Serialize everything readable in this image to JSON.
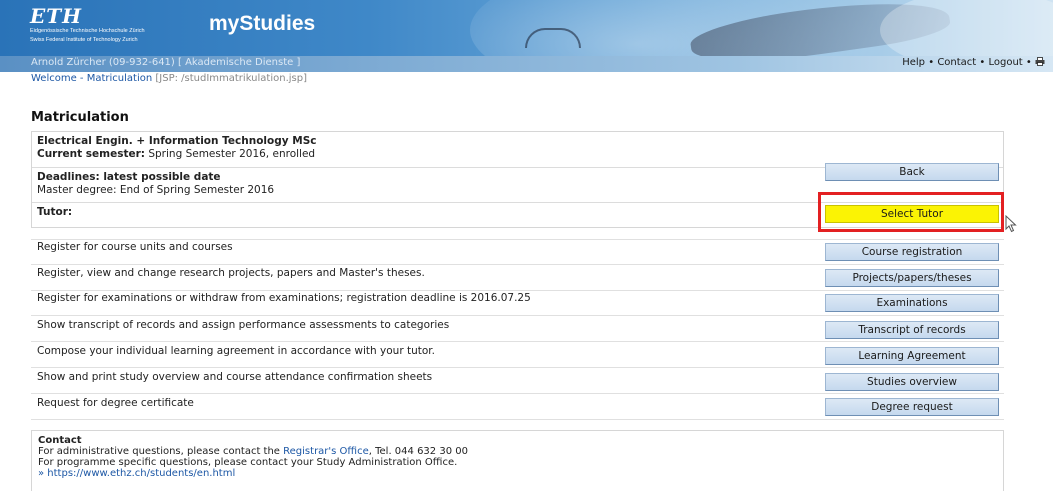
{
  "header": {
    "logo_text": "ETH",
    "institution_line1": "Eidgenössische Technische Hochschule Zürich",
    "institution_line2": "Swiss Federal Institute of Technology Zurich",
    "app_title": "myStudies",
    "user_info": "Arnold Zürcher (09-932-641) [ Akademische Dienste ]",
    "links": [
      "Help",
      "Contact",
      "Logout"
    ],
    "separator": " • ",
    "print_icon": "printer-icon"
  },
  "breadcrumb": {
    "welcome": "Welcome",
    "sep": " - ",
    "current": "Matriculation",
    "jsp": " [JSP: /studImmatrikulation.jsp]"
  },
  "page_title": "Matriculation",
  "program": {
    "name": "Electrical Engin. + Information Technology MSc",
    "semester_label": "Current semester:",
    "semester_value": " Spring Semester 2016, enrolled",
    "deadlines_label": "Deadlines: latest possible date",
    "deadline_value": "Master degree: End of Spring Semester 2016",
    "tutor_label": "Tutor:",
    "back_button": "Back",
    "select_tutor_button": "Select Tutor"
  },
  "actions": [
    {
      "text": "Register for course units and courses",
      "button": "Course registration"
    },
    {
      "text": "Register, view and change research projects, papers and Master's theses.",
      "button": "Projects/papers/theses"
    },
    {
      "text": "Register for examinations or withdraw from examinations; registration deadline is 2016.07.25",
      "button": "Examinations"
    },
    {
      "text": "Show transcript of records and assign performance assessments to categories",
      "button": "Transcript of records"
    },
    {
      "text": "Compose your individual learning agreement in accordance with your tutor.",
      "button": "Learning Agreement"
    },
    {
      "text": "Show and print study overview and course attendance confirmation sheets",
      "button": "Studies overview"
    },
    {
      "text": "Request for degree certificate",
      "button": "Degree request"
    }
  ],
  "contact": {
    "title": "Contact",
    "line1_pre": "For administrative questions, please contact the ",
    "line1_link": "Registrar's Office",
    "line1_post": ", Tel. 044 632 30 00",
    "line2": "For programme specific questions, please contact your Study Administration Office.",
    "line3_link": "» https://www.ethz.ch/students/en.html"
  },
  "colors": {
    "highlight": "#e32022",
    "select_tutor_bg": "#fbf304",
    "deadline_red": "#e2231a",
    "link_blue": "#1c57a5"
  }
}
